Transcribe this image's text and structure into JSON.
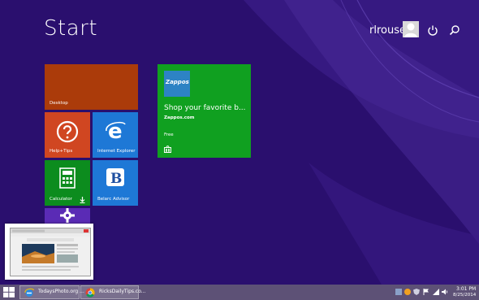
{
  "start": {
    "title": "Start"
  },
  "user": {
    "name": "rlrouse"
  },
  "tiles": {
    "desktop": {
      "label": "Desktop"
    },
    "help": {
      "label": "Help+Tips"
    },
    "ie": {
      "label": "Internet Explorer"
    },
    "calculator": {
      "label": "Calculator"
    },
    "belarc": {
      "label": "Belarc Advisor"
    },
    "zappos": {
      "logo": "Zappos",
      "title": "Shop your favorite b...",
      "subtitle": "Zappos.com",
      "price": "Free"
    }
  },
  "taskbar": {
    "items": [
      {
        "label": "TodaysPhoto.org ..."
      },
      {
        "label": "RicksDailyTips.co..."
      }
    ],
    "clock": {
      "time": "3:01 PM",
      "date": "8/25/2014"
    }
  },
  "colors": {
    "background": "#2a0f6e",
    "desktop_tile": "#ab3b0a",
    "help_tile": "#d04621",
    "blue_tile": "#1e78d6",
    "green_tile": "#0c8c1e",
    "store_tile": "#10a020",
    "taskbar": "#5d5176"
  }
}
